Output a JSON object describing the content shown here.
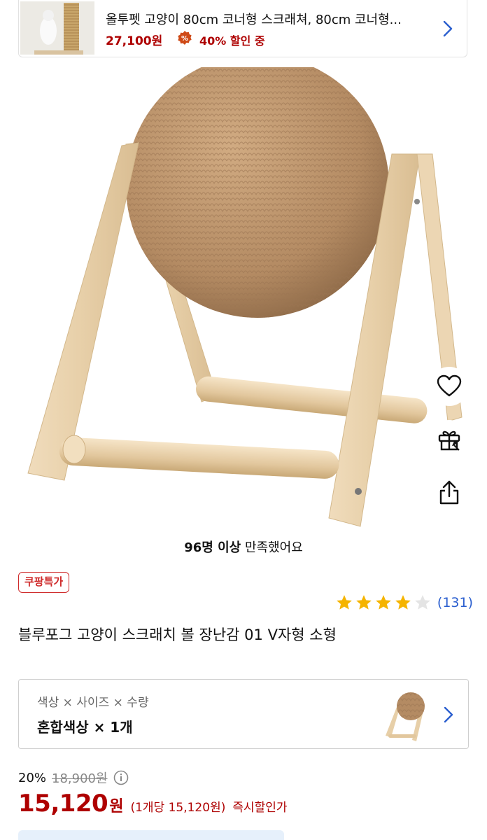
{
  "promo": {
    "title": "올투펫 고양이 80cm 코너형 스크래쳐, 80cm 코너형...",
    "price": "27,100원",
    "discount": "40% 할인 중"
  },
  "hero": {
    "satisfaction_count": "96명 이상",
    "satisfaction_text": " 만족했어요"
  },
  "product": {
    "tag": "쿠팡특가",
    "rating_value": 4,
    "rating_max": 5,
    "review_count": "(131)",
    "title": "블루포그 고양이 스크래치 볼 장난감 01 V자형 소형"
  },
  "option": {
    "label": "색상 × 사이즈 × 수량",
    "value": "혼합색상 × 1개"
  },
  "price": {
    "discount_rate": "20%",
    "original": "18,900원",
    "final": "15,120",
    "currency": "원",
    "unit_price": "(1개당 15,120원)",
    "instant": "즉시할인가"
  },
  "colors": {
    "accent_red": "#ae0000",
    "link_blue": "#2b5fcf",
    "star": "#f5b400"
  }
}
